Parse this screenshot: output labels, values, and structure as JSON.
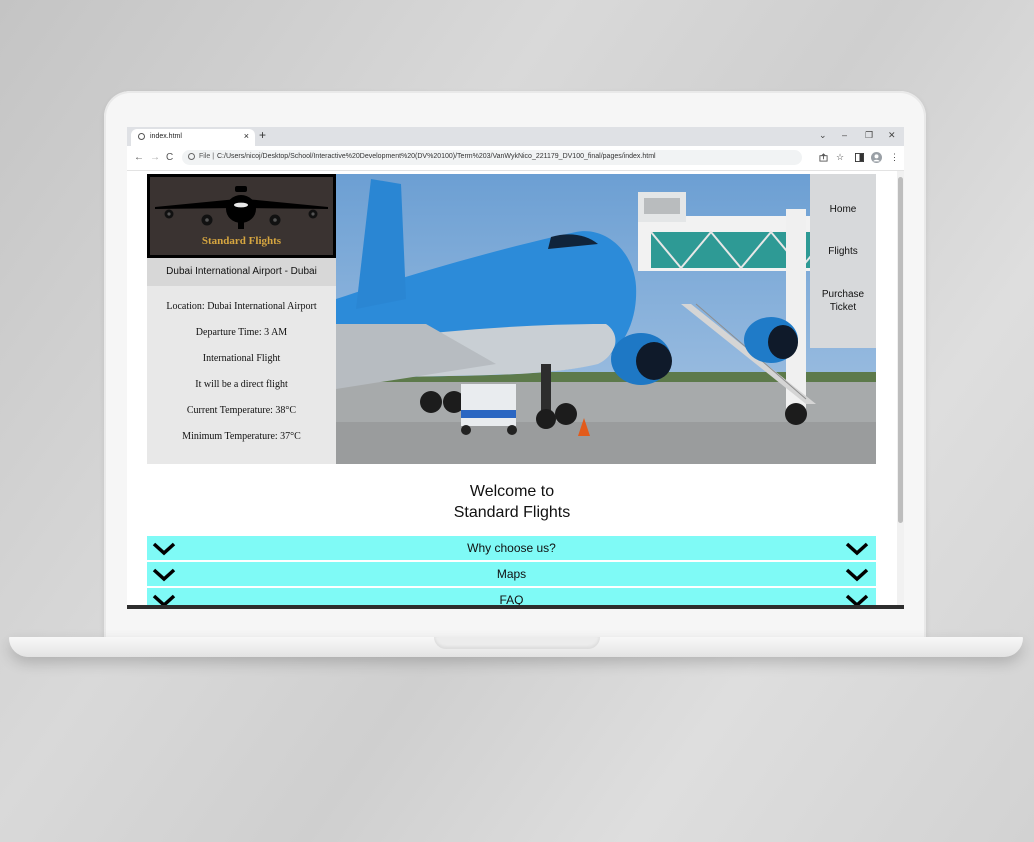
{
  "browser": {
    "tab_title": "index.html",
    "tab_close": "×",
    "new_tab": "+",
    "window_controls": [
      "⌄",
      "–",
      "❐",
      "✕"
    ],
    "back": "←",
    "forward": "→",
    "reload": "C",
    "file_label": "File |",
    "url": "C:/Users/nicoj/Desktop/School/Interactive%20Development%20(DV%20100)/Term%203/VanWykNico_221179_DV100_final/pages/index.html"
  },
  "site": {
    "logo_text": "Standard Flights",
    "airport": "Dubai International Airport - Dubai",
    "details": [
      "Location: Dubai International Airport",
      "Departure Time: 3 AM",
      "International Flight",
      "It will be a direct flight",
      "Current Temperature: 38°C",
      "Minimum Temperature: 37°C"
    ],
    "nav": {
      "home": "Home",
      "flights": "Flights",
      "purchase_line1": "Purchase",
      "purchase_line2": "Ticket"
    },
    "welcome_line1": "Welcome to",
    "welcome_line2": "Standard Flights",
    "accordion": [
      "Why choose us?",
      "Maps",
      "FAQ"
    ]
  },
  "colors": {
    "accordion_bg": "#7ffaf6",
    "logo_bg": "#3a3331",
    "logo_text": "#d6a640",
    "nav_bg": "#d7d9db"
  }
}
